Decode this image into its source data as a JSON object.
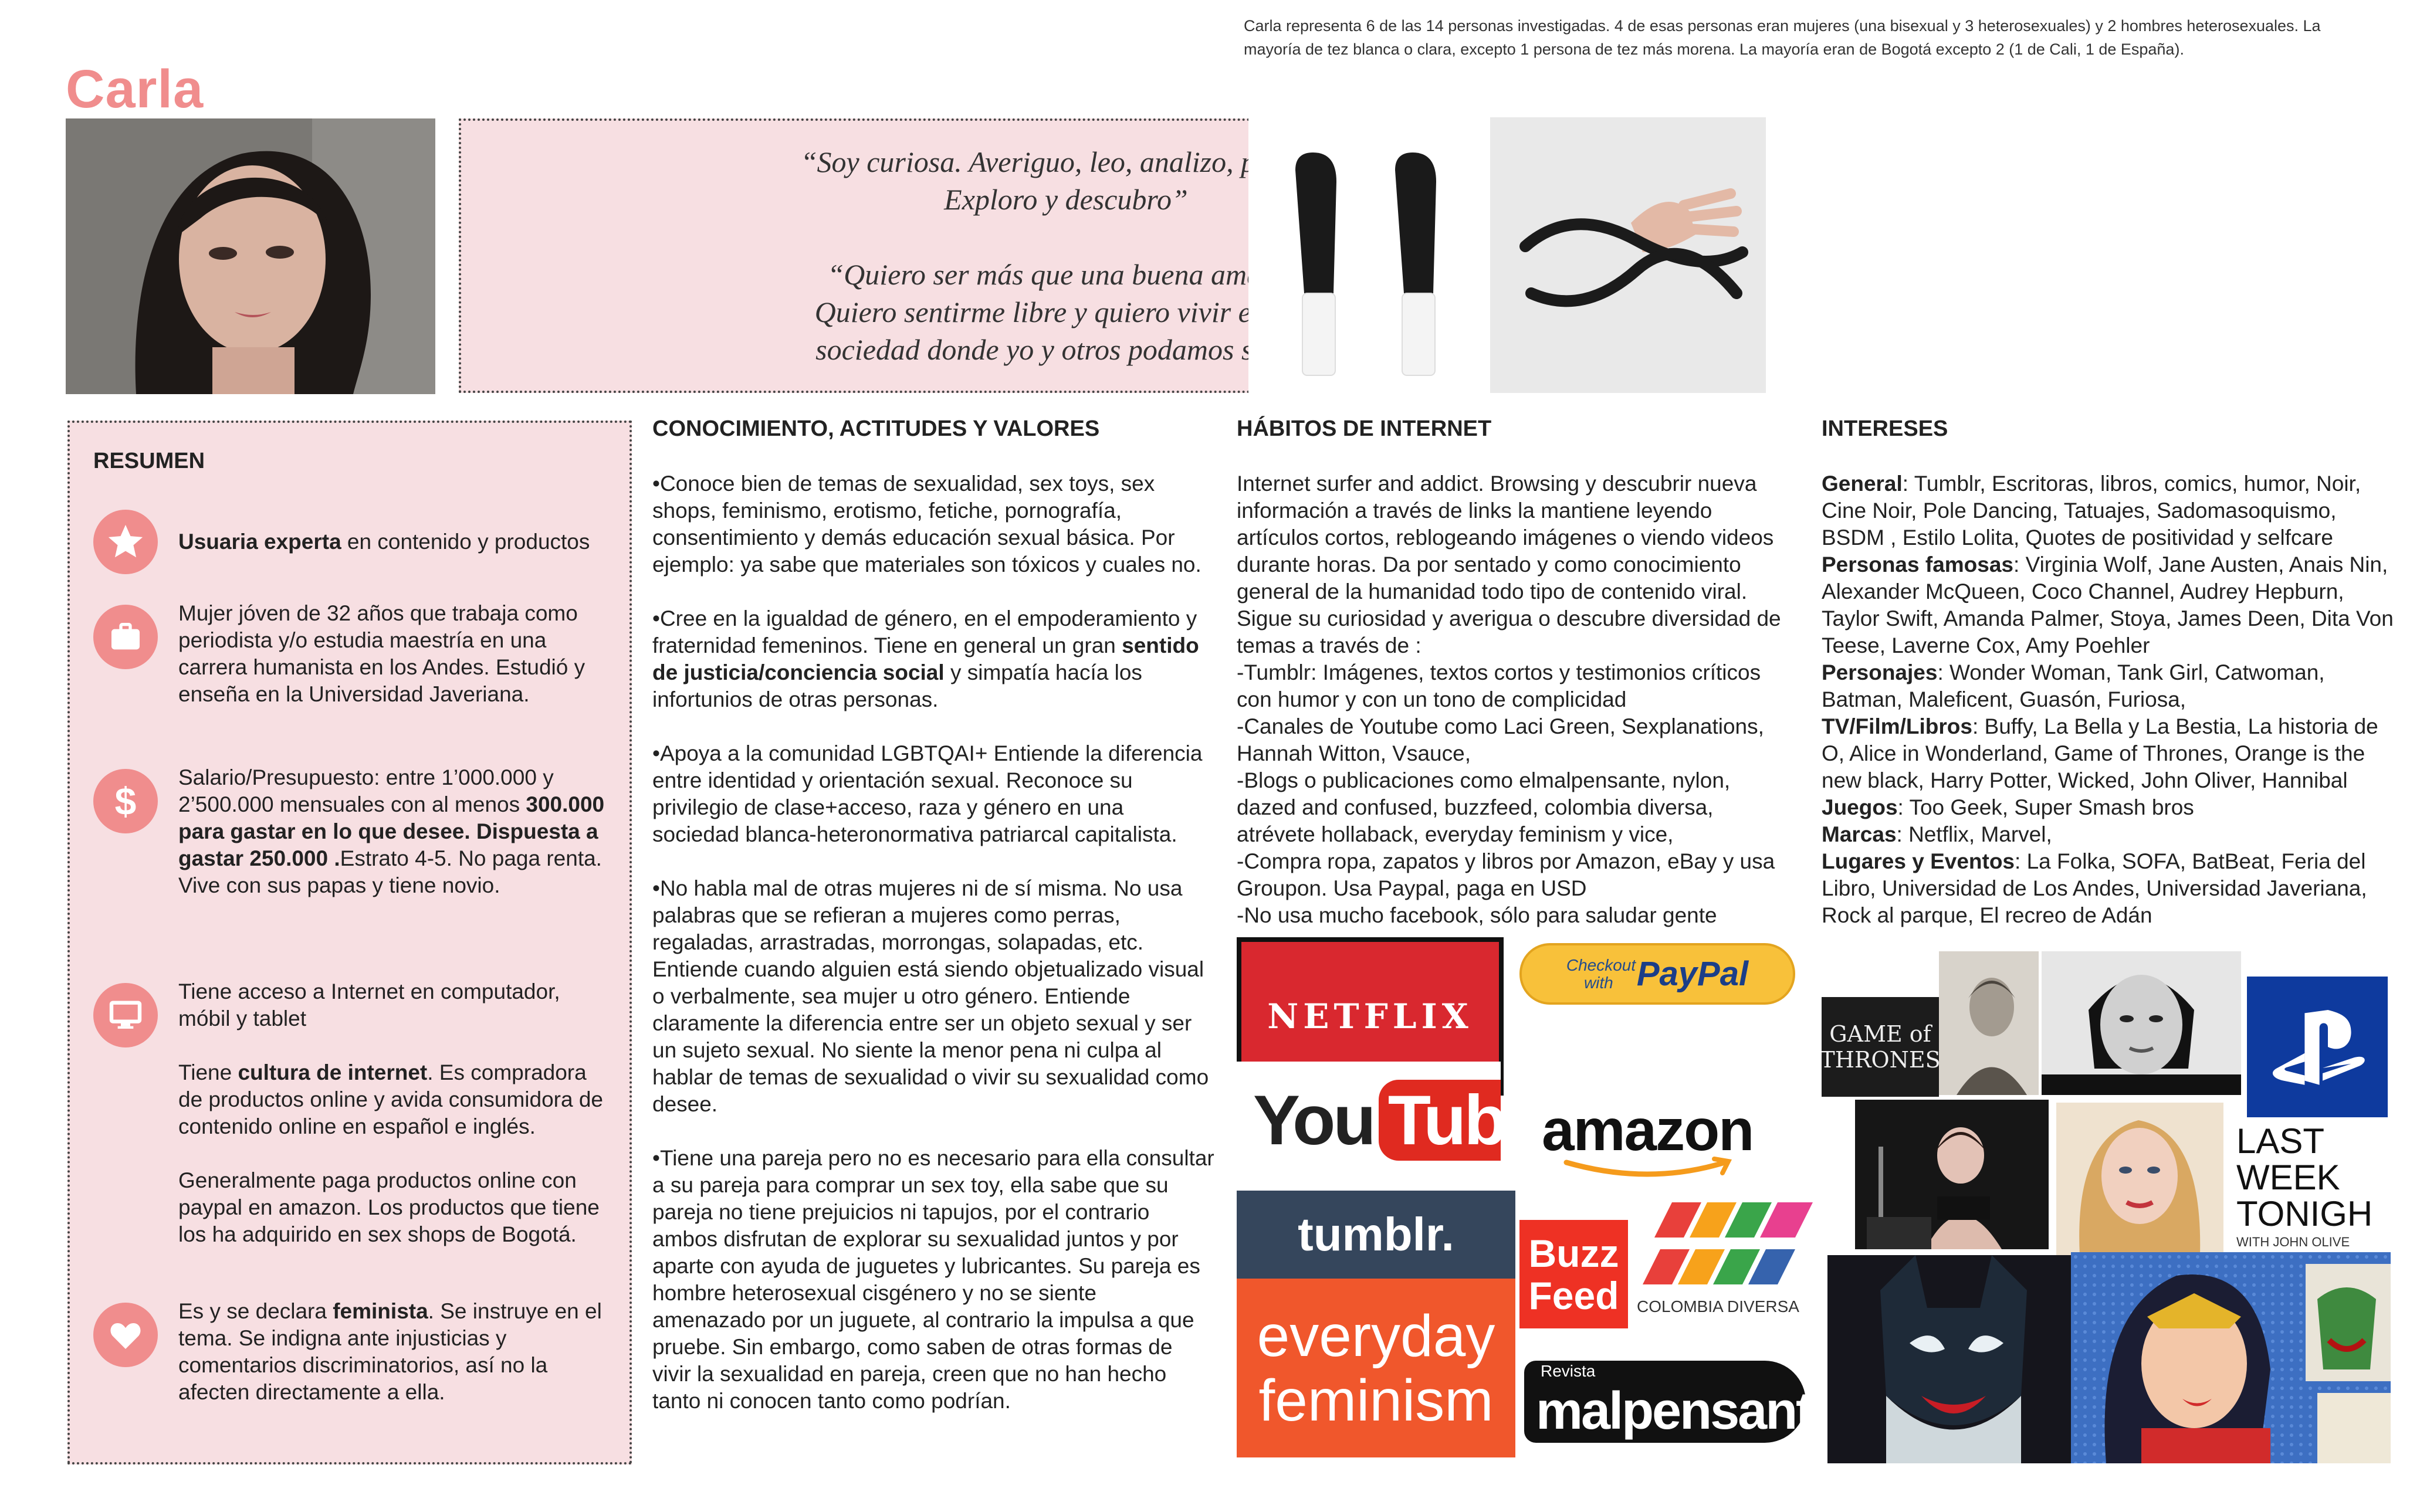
{
  "persona": {
    "name": "Carla",
    "research_note": "Carla representa 6 de las 14 personas investigadas. 4 de esas personas eran mujeres  (una bisexual y 3 heterosexuales) y 2 hombres heterosexuales. La mayoría de tez blanca o clara, excepto 1 persona de tez más morena. La mayoría eran de Bogotá excepto 2 (1 de Cali, 1 de España).",
    "quote_1": "“Soy curiosa. Averiguo, leo, analizo, pruebo.\nExploro y descubro”",
    "quote_2": "“Quiero ser más que una buena amante.\nQuiero sentirme libre y quiero vivir en una\nsociedad donde yo y otros podamos serlo”"
  },
  "summary": {
    "heading": "RESUMEN",
    "expert": {
      "bold": "Usuaria experta",
      "rest": " en contenido y productos"
    },
    "profile": "Mujer jóven de 32 años que trabaja como periodista y/o estudia maestría en una carrera humanista en los Andes. Estudió y enseña en la Universidad Javeriana.",
    "budget_a": "Salario/Presupuesto: entre 1’000.000 y 2’500.000 mensuales con al menos ",
    "budget_b": "300.000 para gastar en lo que desee. Dispuesta a gastar 250.000 .",
    "budget_c": "Estrato 4-5. No paga renta. Vive con sus papas y tiene novio.",
    "access": "Tiene acceso a Internet en computador, móbil y tablet",
    "culture_a": "Tiene ",
    "culture_b": "cultura de internet",
    "culture_c": ". Es compradora de productos online y avida consumidora de contenido online en español e inglés.",
    "payment": "Generalmente paga productos online con paypal  en amazon. Los productos que tiene los ha adquirido en sex shops de Bogotá.",
    "feminist_a": "Es y se declara ",
    "feminist_b": "feminista",
    "feminist_c": ". Se instruye en el tema. Se indigna ante injusticias y comentarios discriminatorios, así no la afecten directamente a ella."
  },
  "knowledge": {
    "heading": "CONOCIMIENTO, ACTITUDES Y VALORES",
    "p1": "•Conoce bien de temas de sexualidad, sex toys, sex shops, feminismo, erotismo, fetiche, pornografía, consentimiento y demás educación sexual básica. Por ejemplo: ya sabe que materiales son tóxicos y cuales no.",
    "p2a": "•Cree en la igualdad de género, en el empoderamiento  y fraternidad femeninos. Tiene en general un gran ",
    "p2b": "sentido de justicia/conciencia social",
    "p2c": " y simpatía hacía los infortunios de otras personas.",
    "p3": "•Apoya a la comunidad LGBTQAI+ Entiende la diferencia entre identidad y orientación sexual. Reconoce su privilegio de clase+acceso, raza y género en una sociedad blanca-heteronormativa patriarcal capitalista.",
    "p4": "•No habla mal de otras mujeres ni de sí misma. No usa palabras que se refieran a mujeres como perras, regaladas, arrastradas, morrongas, solapadas, etc. Entiende cuando alguien está siendo objetualizado visual o verbalmente, sea mujer u otro género. Entiende claramente la diferencia entre ser un objeto sexual y ser un sujeto sexual. No siente la menor pena ni culpa al hablar de temas de sexualidad o vivir su sexualidad como desee.",
    "p5": "•Tiene una pareja pero no es necesario para ella consultar a su pareja para comprar un sex toy, ella sabe que su pareja no tiene prejuicios ni tapujos, por el contrario ambos disfrutan de explorar su sexualidad juntos y por aparte con ayuda de juguetes y lubricantes. Su pareja es hombre heterosexual cisgénero y no se siente amenazado por un juguete, al contrario la impulsa a que pruebe. Sin embargo, como saben de otras formas de vivir la sexualidad  en pareja, creen que no han hecho tanto ni conocen tanto como podrían."
  },
  "habits": {
    "heading": "HÁBITOS DE INTERNET",
    "text": "Internet surfer and addict. Browsing y descubrir nueva información a través de links la mantiene leyendo artículos cortos, reblogeando imágenes o viendo videos durante horas. Da por sentado y como conocimiento general de la humanidad  todo tipo de contenido viral. Sigue su curiosidad y averigua o descubre diversidad de temas a través de :\n-Tumblr: Imágenes, textos cortos y testimonios críticos con humor y con un tono de complicidad\n-Canales de Youtube como Laci Green, Sexplanations, Hannah Witton, Vsauce,\n-Blogs o publicaciones como elmalpensante,  nylon, dazed and confused, buzzfeed,  colombia diversa, atrévete hollaback, everyday feminism y vice,\n-Compra ropa, zapatos y libros por Amazon, eBay y usa Groupon. Usa Paypal, paga en USD\n-No usa mucho facebook, sólo para saludar gente",
    "logos": {
      "netflix": "NETFLIX",
      "paypal_small": "Checkout with",
      "paypal": "PayPal",
      "youtube_you": "You",
      "youtube_tube": "Tube",
      "amazon": "amazon",
      "tumblr": "tumblr.",
      "buzz": "Buzz",
      "feed": "Feed",
      "colombia": "COLOMBIA DIVERSA",
      "everyday": "everyday",
      "feminism": "feminism",
      "revista": "Revista",
      "malpensante": "malpensante"
    }
  },
  "interests": {
    "heading": "INTERESES",
    "items": [
      {
        "label": "General",
        "value": ": Tumblr, Escritoras, libros, comics, humor, Noir, Cine Noir, Pole Dancing, Tatuajes, Sadomasoquismo, BSDM , Estilo Lolita, Quotes de positividad y selfcare"
      },
      {
        "label": "Personas famosas",
        "value": ": Virginia Wolf, Jane Austen, Anais Nin, Alexander McQueen, Coco Channel, Audrey Hepburn, Taylor Swift, Amanda Palmer, Stoya, James Deen, Dita Von Teese,  Laverne Cox, Amy Poehler"
      },
      {
        "label": "Personajes",
        "value": ": Wonder Woman, Tank Girl, Catwoman, Batman, Maleficent, Guasón, Furiosa,"
      },
      {
        "label": "TV/Film/Libros",
        "value": ": Buffy, La Bella y La Bestia, La historia de O, Alice in Wonderland, Game of Thrones, Orange is the new black, Harry Potter, Wicked, John Oliver, Hannibal"
      },
      {
        "label": "Juegos",
        "value": ": Too Geek, Super Smash bros"
      },
      {
        "label": "Marcas",
        "value": ": Netflix, Marvel,"
      },
      {
        "label": "Lugares y Eventos",
        "value": ": La Folka, SOFA, BatBeat, Feria del Libro, Universidad de Los Andes, Universidad Javeriana, Rock al parque, El recreo de Adán"
      }
    ],
    "collage": {
      "got_1": "GAME of",
      "got_2": "THRONES",
      "lwt_1": "LAST",
      "lwt_2": "WEEK",
      "lwt_3": "TONIGH",
      "lwt_4": "WITH JOHN OLIVE"
    }
  },
  "colors": {
    "accent": "#f08d8d",
    "panel": "#f7dfe2"
  }
}
